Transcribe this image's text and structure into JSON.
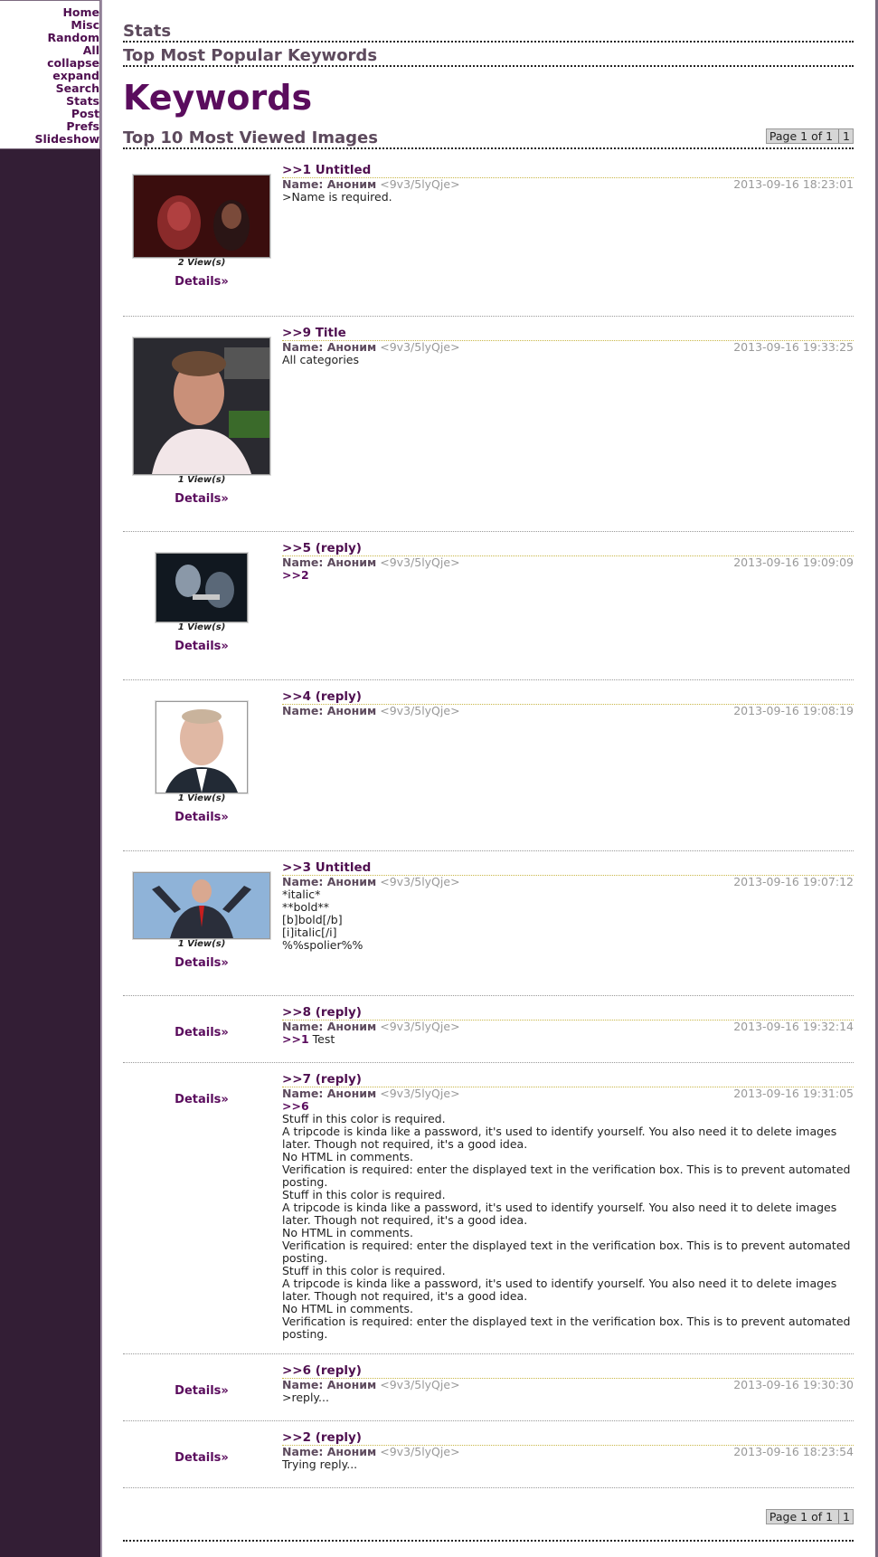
{
  "nav": [
    "Home",
    "Misc",
    "Random",
    "All",
    "collapse",
    "expand",
    "Search",
    "Stats",
    "Post",
    "Prefs",
    "Slideshow"
  ],
  "headings": {
    "stats": "Stats",
    "popular": "Top Most Popular Keywords",
    "keywords": "Keywords",
    "top10": "Top 10 Most Viewed Images"
  },
  "pager": {
    "label": "Page 1 of 1",
    "page": "1"
  },
  "details_label": "Details»",
  "posts": [
    {
      "title": ">>1 Untitled",
      "name": "Name: Аноним",
      "trip": "<9v3/5lyQje>",
      "date": "2013-09-16 18:23:01",
      "text": ">Name is required.",
      "views": "2 View(s)"
    },
    {
      "title": ">>9 Title",
      "name": "Name: Аноним",
      "trip": "<9v3/5lyQje>",
      "date": "2013-09-16 19:33:25",
      "text": "All categories",
      "views": "1 View(s)"
    },
    {
      "title": ">>5 (reply)",
      "name": "Name: Аноним",
      "trip": "<9v3/5lyQje>",
      "date": "2013-09-16 19:09:09",
      "ref": ">>2",
      "views": "1 View(s)"
    },
    {
      "title": ">>4 (reply)",
      "name": "Name: Аноним",
      "trip": "<9v3/5lyQje>",
      "date": "2013-09-16 19:08:19",
      "views": "1 View(s)"
    },
    {
      "title": ">>3 Untitled",
      "name": "Name: Аноним",
      "trip": "<9v3/5lyQje>",
      "date": "2013-09-16 19:07:12",
      "text": "*italic*\n**bold**\n[b]bold[/b]\n[i]italic[/i]\n%%spolier%%",
      "views": "1 View(s)"
    },
    {
      "title": ">>8 (reply)",
      "name": "Name: Аноним",
      "trip": "<9v3/5lyQje>",
      "date": "2013-09-16 19:32:14",
      "ref": ">>1",
      "text": " Test"
    },
    {
      "title": ">>7 (reply)",
      "name": "Name: Аноним",
      "trip": "<9v3/5lyQje>",
      "date": "2013-09-16 19:31:05",
      "ref": ">>6",
      "text": "Stuff in this color is required.\nA tripcode is kinda like a password, it's used to identify yourself. You also need it to delete images later. Though not required, it's a good idea.\nNo HTML in comments.\nVerification is required: enter the displayed text in the verification box. This is to prevent automated posting.\nStuff in this color is required.\nA tripcode is kinda like a password, it's used to identify yourself. You also need it to delete images later. Though not required, it's a good idea.\nNo HTML in comments.\nVerification is required: enter the displayed text in the verification box. This is to prevent automated posting.\nStuff in this color is required.\nA tripcode is kinda like a password, it's used to identify yourself. You also need it to delete images later. Though not required, it's a good idea.\nNo HTML in comments.\nVerification is required: enter the displayed text in the verification box. This is to prevent automated posting."
    },
    {
      "title": ">>6 (reply)",
      "name": "Name: Аноним",
      "trip": "<9v3/5lyQje>",
      "date": "2013-09-16 19:30:30",
      "text": ">reply..."
    },
    {
      "title": ">>2 (reply)",
      "name": "Name: Аноним",
      "trip": "<9v3/5lyQje>",
      "date": "2013-09-16 18:23:54",
      "text": "Trying reply..."
    }
  ]
}
